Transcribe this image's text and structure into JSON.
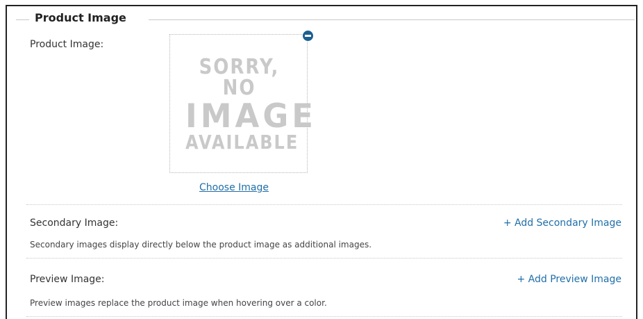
{
  "section": {
    "legend": "Product Image"
  },
  "product_image": {
    "label": "Product Image:",
    "placeholder_line1": "SORRY, NO",
    "placeholder_line2": "IMAGE",
    "placeholder_line3": "AVAILABLE",
    "remove_icon": "minus-circle-icon",
    "choose_link": "Choose Image"
  },
  "secondary_image": {
    "label": "Secondary Image:",
    "add_link": "+ Add Secondary Image",
    "description": "Secondary images display directly below the product image as additional images."
  },
  "preview_image": {
    "label": "Preview Image:",
    "add_link": "+ Add Preview Image",
    "description": "Preview images replace the product image when hovering over a color."
  },
  "colors": {
    "link": "#1f6ea8",
    "remove_icon": "#1d5f92",
    "placeholder_text": "#c9c9c9"
  }
}
